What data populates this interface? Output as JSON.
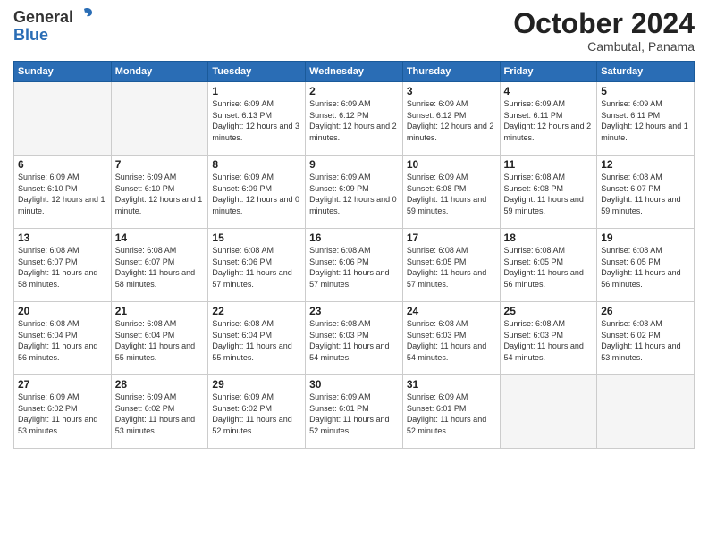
{
  "header": {
    "logo_general": "General",
    "logo_blue": "Blue",
    "month_title": "October 2024",
    "location": "Cambutal, Panama"
  },
  "weekdays": [
    "Sunday",
    "Monday",
    "Tuesday",
    "Wednesday",
    "Thursday",
    "Friday",
    "Saturday"
  ],
  "weeks": [
    [
      {
        "day": "",
        "info": ""
      },
      {
        "day": "",
        "info": ""
      },
      {
        "day": "1",
        "info": "Sunrise: 6:09 AM\nSunset: 6:13 PM\nDaylight: 12 hours and 3 minutes."
      },
      {
        "day": "2",
        "info": "Sunrise: 6:09 AM\nSunset: 6:12 PM\nDaylight: 12 hours and 2 minutes."
      },
      {
        "day": "3",
        "info": "Sunrise: 6:09 AM\nSunset: 6:12 PM\nDaylight: 12 hours and 2 minutes."
      },
      {
        "day": "4",
        "info": "Sunrise: 6:09 AM\nSunset: 6:11 PM\nDaylight: 12 hours and 2 minutes."
      },
      {
        "day": "5",
        "info": "Sunrise: 6:09 AM\nSunset: 6:11 PM\nDaylight: 12 hours and 1 minute."
      }
    ],
    [
      {
        "day": "6",
        "info": "Sunrise: 6:09 AM\nSunset: 6:10 PM\nDaylight: 12 hours and 1 minute."
      },
      {
        "day": "7",
        "info": "Sunrise: 6:09 AM\nSunset: 6:10 PM\nDaylight: 12 hours and 1 minute."
      },
      {
        "day": "8",
        "info": "Sunrise: 6:09 AM\nSunset: 6:09 PM\nDaylight: 12 hours and 0 minutes."
      },
      {
        "day": "9",
        "info": "Sunrise: 6:09 AM\nSunset: 6:09 PM\nDaylight: 12 hours and 0 minutes."
      },
      {
        "day": "10",
        "info": "Sunrise: 6:09 AM\nSunset: 6:08 PM\nDaylight: 11 hours and 59 minutes."
      },
      {
        "day": "11",
        "info": "Sunrise: 6:08 AM\nSunset: 6:08 PM\nDaylight: 11 hours and 59 minutes."
      },
      {
        "day": "12",
        "info": "Sunrise: 6:08 AM\nSunset: 6:07 PM\nDaylight: 11 hours and 59 minutes."
      }
    ],
    [
      {
        "day": "13",
        "info": "Sunrise: 6:08 AM\nSunset: 6:07 PM\nDaylight: 11 hours and 58 minutes."
      },
      {
        "day": "14",
        "info": "Sunrise: 6:08 AM\nSunset: 6:07 PM\nDaylight: 11 hours and 58 minutes."
      },
      {
        "day": "15",
        "info": "Sunrise: 6:08 AM\nSunset: 6:06 PM\nDaylight: 11 hours and 57 minutes."
      },
      {
        "day": "16",
        "info": "Sunrise: 6:08 AM\nSunset: 6:06 PM\nDaylight: 11 hours and 57 minutes."
      },
      {
        "day": "17",
        "info": "Sunrise: 6:08 AM\nSunset: 6:05 PM\nDaylight: 11 hours and 57 minutes."
      },
      {
        "day": "18",
        "info": "Sunrise: 6:08 AM\nSunset: 6:05 PM\nDaylight: 11 hours and 56 minutes."
      },
      {
        "day": "19",
        "info": "Sunrise: 6:08 AM\nSunset: 6:05 PM\nDaylight: 11 hours and 56 minutes."
      }
    ],
    [
      {
        "day": "20",
        "info": "Sunrise: 6:08 AM\nSunset: 6:04 PM\nDaylight: 11 hours and 56 minutes."
      },
      {
        "day": "21",
        "info": "Sunrise: 6:08 AM\nSunset: 6:04 PM\nDaylight: 11 hours and 55 minutes."
      },
      {
        "day": "22",
        "info": "Sunrise: 6:08 AM\nSunset: 6:04 PM\nDaylight: 11 hours and 55 minutes."
      },
      {
        "day": "23",
        "info": "Sunrise: 6:08 AM\nSunset: 6:03 PM\nDaylight: 11 hours and 54 minutes."
      },
      {
        "day": "24",
        "info": "Sunrise: 6:08 AM\nSunset: 6:03 PM\nDaylight: 11 hours and 54 minutes."
      },
      {
        "day": "25",
        "info": "Sunrise: 6:08 AM\nSunset: 6:03 PM\nDaylight: 11 hours and 54 minutes."
      },
      {
        "day": "26",
        "info": "Sunrise: 6:08 AM\nSunset: 6:02 PM\nDaylight: 11 hours and 53 minutes."
      }
    ],
    [
      {
        "day": "27",
        "info": "Sunrise: 6:09 AM\nSunset: 6:02 PM\nDaylight: 11 hours and 53 minutes."
      },
      {
        "day": "28",
        "info": "Sunrise: 6:09 AM\nSunset: 6:02 PM\nDaylight: 11 hours and 53 minutes."
      },
      {
        "day": "29",
        "info": "Sunrise: 6:09 AM\nSunset: 6:02 PM\nDaylight: 11 hours and 52 minutes."
      },
      {
        "day": "30",
        "info": "Sunrise: 6:09 AM\nSunset: 6:01 PM\nDaylight: 11 hours and 52 minutes."
      },
      {
        "day": "31",
        "info": "Sunrise: 6:09 AM\nSunset: 6:01 PM\nDaylight: 11 hours and 52 minutes."
      },
      {
        "day": "",
        "info": ""
      },
      {
        "day": "",
        "info": ""
      }
    ]
  ]
}
